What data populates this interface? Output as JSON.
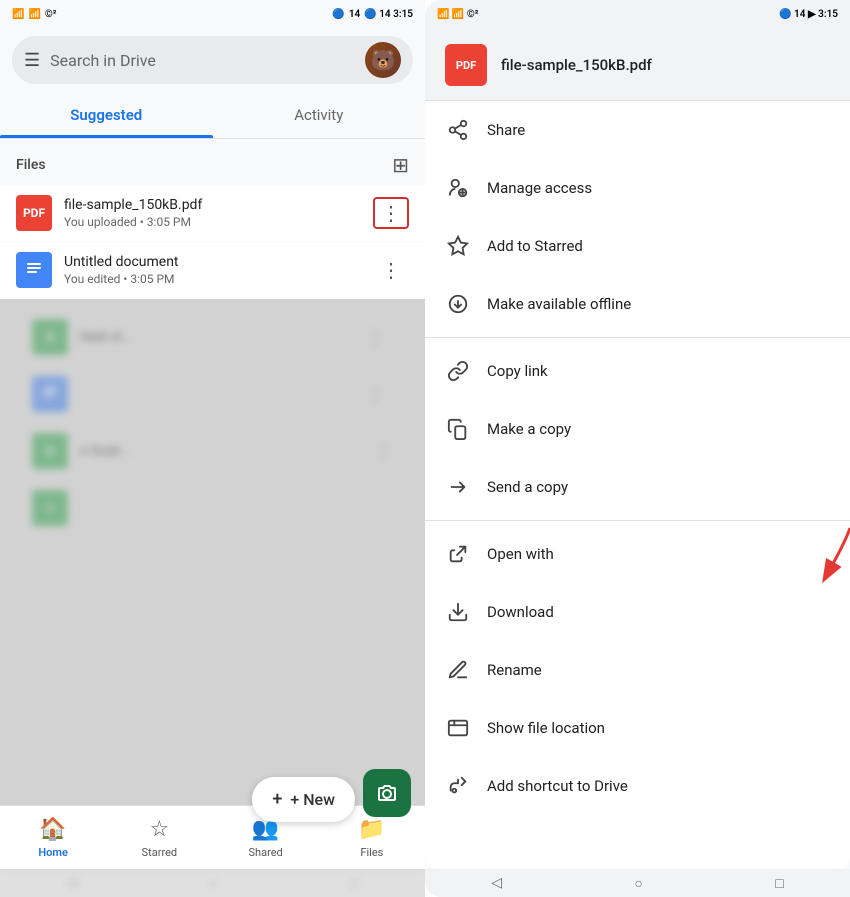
{
  "left": {
    "statusBar": {
      "left": "📶 📶 ©²",
      "right": "🔵 14 3:15"
    },
    "searchPlaceholder": "Search in Drive",
    "tabs": [
      {
        "id": "suggested",
        "label": "Suggested",
        "active": true
      },
      {
        "id": "activity",
        "label": "Activity",
        "active": false
      }
    ],
    "filesLabel": "Files",
    "files": [
      {
        "id": "pdf1",
        "name": "file-sample_150kB.pdf",
        "meta": "You uploaded • 3:05 PM",
        "type": "pdf",
        "iconLabel": "PDF",
        "highlighted": true
      },
      {
        "id": "doc1",
        "name": "Untitled document",
        "meta": "You edited • 3:05 PM",
        "type": "doc",
        "iconLabel": "≡",
        "highlighted": false
      }
    ],
    "blurredFiles": [
      {
        "id": "sheet1",
        "name": "heet.xl...",
        "type": "sheet",
        "iconLabel": "X"
      },
      {
        "id": "doc2",
        "name": "",
        "type": "doc",
        "iconLabel": "≡"
      },
      {
        "id": "sheet2",
        "name": "s Guid...",
        "type": "sheet",
        "iconLabel": "X"
      },
      {
        "id": "plus1",
        "name": "",
        "type": "plus",
        "iconLabel": "+"
      }
    ],
    "newButton": "+ New",
    "bottomNav": [
      {
        "id": "home",
        "label": "Home",
        "icon": "🏠",
        "active": true
      },
      {
        "id": "starred",
        "label": "Starred",
        "icon": "☆",
        "active": false
      },
      {
        "id": "shared",
        "label": "Shared",
        "icon": "👥",
        "active": false
      },
      {
        "id": "files",
        "label": "Files",
        "icon": "📁",
        "active": false
      }
    ],
    "systemNav": [
      "◁",
      "○",
      "□"
    ]
  },
  "right": {
    "statusBar": {
      "left": "📶 📶 ©²",
      "right": "🔵 14 3:15"
    },
    "filename": "file-sample_150kB.pdf",
    "menuItems": [
      {
        "id": "share",
        "label": "Share",
        "icon": "share"
      },
      {
        "id": "manage-access",
        "label": "Manage access",
        "icon": "manage"
      },
      {
        "id": "add-starred",
        "label": "Add to Starred",
        "icon": "star"
      },
      {
        "id": "offline",
        "label": "Make available offline",
        "icon": "offline"
      },
      {
        "id": "divider1",
        "type": "divider"
      },
      {
        "id": "copy-link",
        "label": "Copy link",
        "icon": "link"
      },
      {
        "id": "make-copy",
        "label": "Make a copy",
        "icon": "copy"
      },
      {
        "id": "send-copy",
        "label": "Send a copy",
        "icon": "send"
      },
      {
        "id": "divider2",
        "type": "divider"
      },
      {
        "id": "open-with",
        "label": "Open with",
        "icon": "open"
      },
      {
        "id": "download",
        "label": "Download",
        "icon": "download"
      },
      {
        "id": "rename",
        "label": "Rename",
        "icon": "rename"
      },
      {
        "id": "show-location",
        "label": "Show file location",
        "icon": "location"
      },
      {
        "id": "shortcut",
        "label": "Add shortcut to Drive",
        "icon": "shortcut"
      }
    ],
    "systemNav": [
      "◁",
      "○",
      "□"
    ]
  }
}
